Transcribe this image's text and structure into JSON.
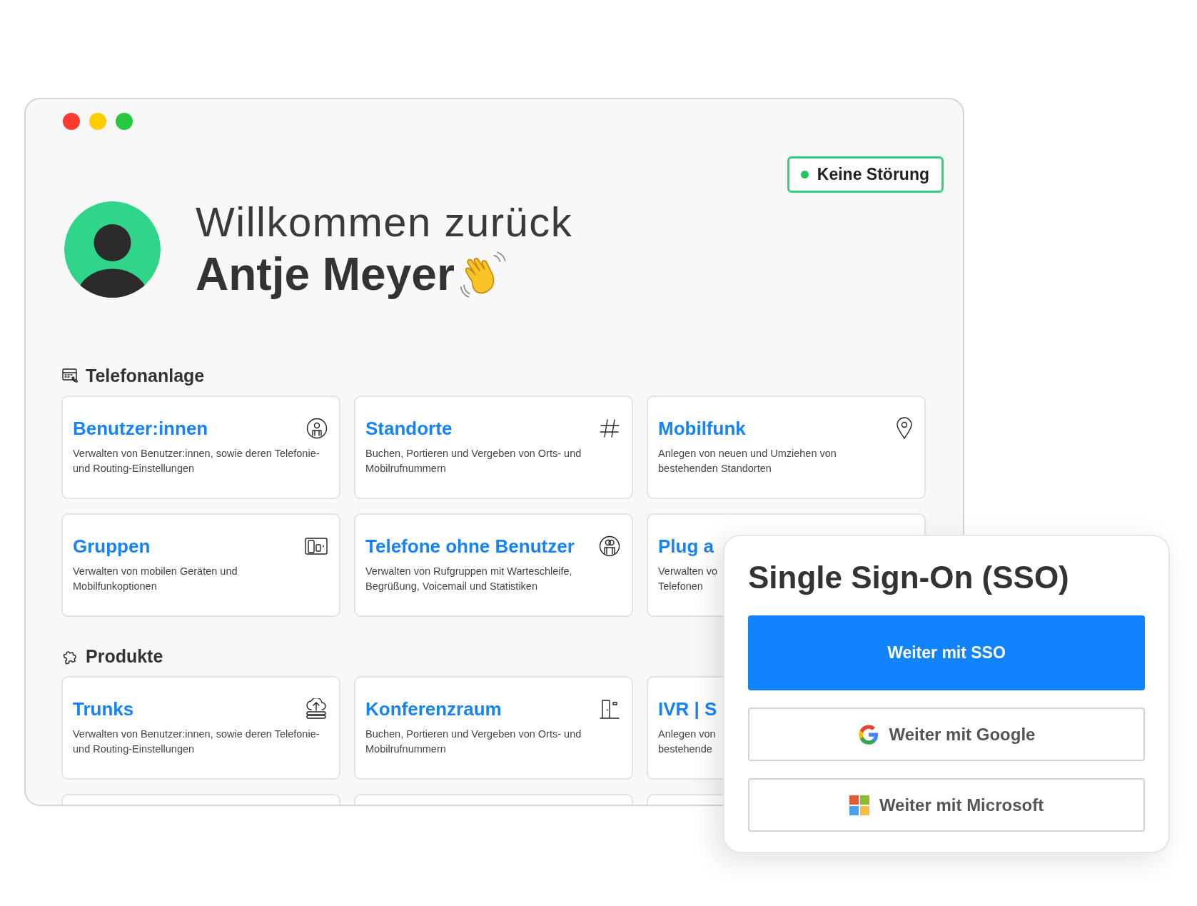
{
  "status_badge": {
    "label": "Keine Störung"
  },
  "greeting": {
    "line": "Willkommen zurück",
    "name": "Antje Meyer"
  },
  "sections": [
    {
      "title": "Telefonanlage",
      "cards": [
        {
          "kind": "full",
          "title": "Benutzer:innen",
          "description": "Verwalten von Benutzer:innen, sowie deren Telefonie-\nund Routing-Einstellungen"
        },
        {
          "kind": "full",
          "title": "Standorte",
          "description": "Buchen, Portieren und Vergeben von Orts- und\nMobilrufnummern"
        },
        {
          "kind": "full",
          "title": "Mobilfunk",
          "description": "Anlegen von neuen und Umziehen von\nbestehenden Standorten"
        },
        {
          "kind": "full",
          "title": "Gruppen",
          "description": "Verwalten von mobilen Geräten und\nMobilfunkoptionen"
        },
        {
          "kind": "full",
          "title": "Telefone ohne Benutzer",
          "description": "Verwalten von Rufgruppen mit Warteschleife,\nBegrüßung, Voicemail und Statistiken"
        },
        {
          "kind": "covered",
          "title": "Plug a",
          "description": "Verwalten vo\nTelefonen"
        }
      ]
    },
    {
      "title": "Produkte",
      "cards": [
        {
          "kind": "full",
          "title": "Trunks",
          "description": "Verwalten von Benutzer:innen, sowie deren Telefonie-\nund Routing-Einstellungen"
        },
        {
          "kind": "full",
          "title": "Konferenzraum",
          "description": "Buchen, Portieren und Vergeben von Orts- und\nMobilrufnummern"
        },
        {
          "kind": "covered",
          "title": "IVR | S",
          "description": "Anlegen von\nbestehende"
        },
        {
          "kind": "cut"
        },
        {
          "kind": "cut"
        },
        {
          "kind": "cut"
        }
      ]
    }
  ],
  "sso_panel": {
    "title": "Single Sign-On (SSO)",
    "buttons": [
      {
        "kind": "primary",
        "label": "Weiter mit SSO"
      },
      {
        "kind": "google",
        "label": "Weiter mit Google"
      },
      {
        "kind": "microsoft",
        "label": "Weiter mit Microsoft"
      }
    ]
  }
}
